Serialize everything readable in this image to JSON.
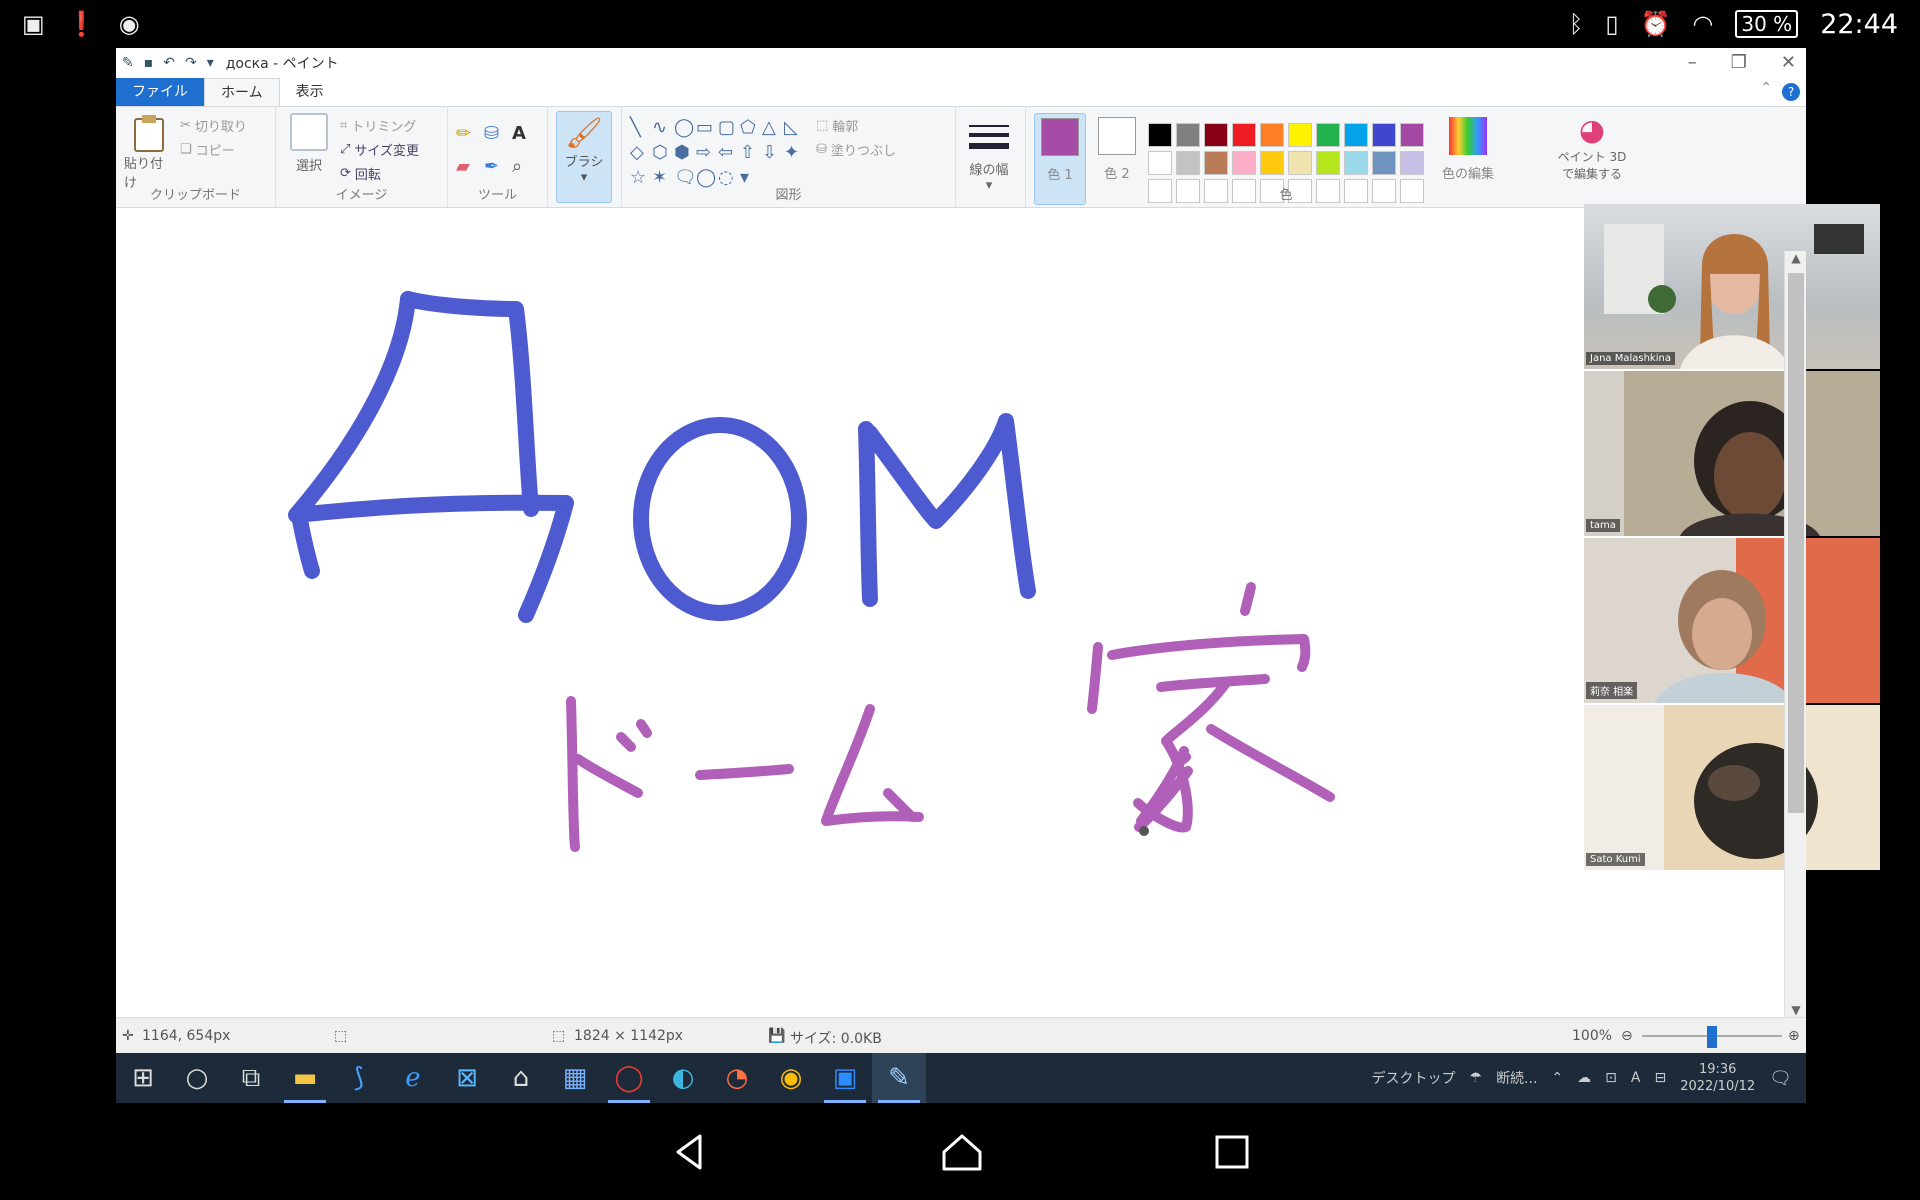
{
  "status_bar": {
    "battery": "30 %",
    "time": "22:44"
  },
  "paint": {
    "title": "доска - ペイント",
    "tabs": [
      {
        "label": "ファイル"
      },
      {
        "label": "ホーム"
      },
      {
        "label": "表示"
      }
    ],
    "ribbon": {
      "clipboard": {
        "paste": "貼り付け",
        "cut": "切り取り",
        "copy": "コピー",
        "group": "クリップボード"
      },
      "image": {
        "select": "選択",
        "crop": "トリミング",
        "resize": "サイズ変更",
        "rotate": "回転",
        "group": "イメージ"
      },
      "tools": {
        "group": "ツール"
      },
      "brush": {
        "label": "ブラシ"
      },
      "shapes": {
        "outline": "輪郭",
        "fill": "塗りつぶし",
        "group": "図形"
      },
      "size": {
        "label": "線の幅"
      },
      "color1": {
        "label": "色 1",
        "value": "#a64ca6"
      },
      "color2": {
        "label": "色 2",
        "value": "#ffffff"
      },
      "edit_colors": {
        "label": "色の編集"
      },
      "paint3d": {
        "label": "ペイント 3D で編集する"
      },
      "colors_group": "色",
      "palette": [
        "#000000",
        "#7f7f7f",
        "#880015",
        "#ed1c24",
        "#ff7f27",
        "#fff200",
        "#22b14c",
        "#00a2e8",
        "#3f48cc",
        "#a349a4",
        "#ffffff",
        "#c3c3c3",
        "#b97a57",
        "#ffaec9",
        "#ffc90e",
        "#efe4b0",
        "#b5e61d",
        "#99d9ea",
        "#7092be",
        "#c8bfe7"
      ]
    },
    "drawing": {
      "word_cyrillic": "Дом",
      "word_katakana": "ドーム",
      "word_kanji": "家",
      "ink_blue": "#4e5bd0",
      "ink_purple": "#b060b8"
    },
    "statusbar": {
      "cursor": "1164, 654px",
      "canvas_size": "1824 × 1142px",
      "file_size": "サイズ: 0.0KB",
      "zoom": "100%"
    },
    "taskbar": {
      "desktop_label": "デスクトップ",
      "weather": "断続...",
      "clock_time": "19:36",
      "clock_date": "2022/10/12"
    }
  },
  "participants": [
    {
      "name": "Jana Malashkina"
    },
    {
      "name": "tama"
    },
    {
      "name": "莉奈 相楽"
    },
    {
      "name": "Sato Kumi"
    }
  ]
}
